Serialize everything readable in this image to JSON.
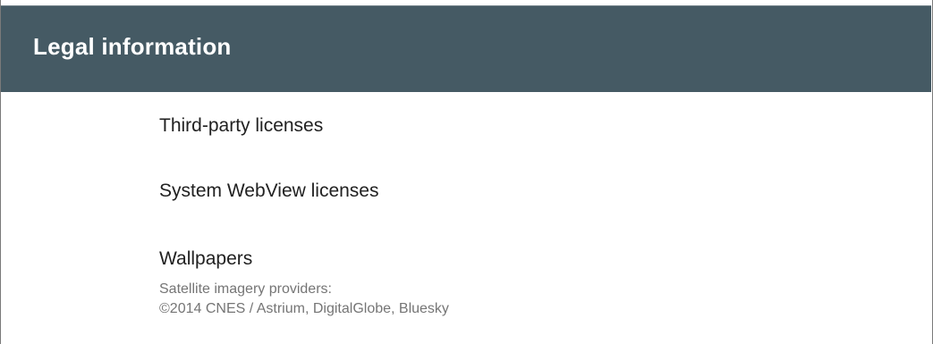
{
  "header": {
    "title": "Legal information",
    "color": "#455a64"
  },
  "items": [
    {
      "title": "Third-party licenses"
    },
    {
      "title": "System WebView licenses"
    },
    {
      "title": "Wallpapers",
      "summary_line1": "Satellite imagery providers:",
      "summary_line2": "©2014 CNES / Astrium, DigitalGlobe, Bluesky"
    }
  ]
}
